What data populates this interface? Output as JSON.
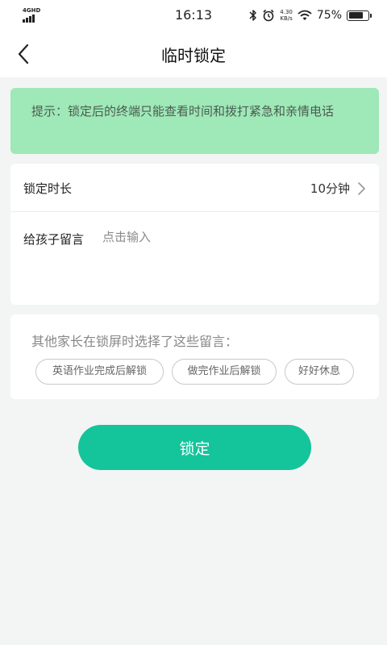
{
  "status_bar": {
    "network": "4GHD",
    "time": "16:13",
    "speed_value": "4.30",
    "speed_unit": "KB/s",
    "battery": "75%",
    "battery_level": 0.75
  },
  "nav": {
    "title": "临时锁定"
  },
  "tip": {
    "text": "提示：锁定后的终端只能查看时间和拨打紧急和亲情电话"
  },
  "lock_duration": {
    "label": "锁定时长",
    "value": "10分钟"
  },
  "message": {
    "label": "给孩子留言",
    "placeholder": "点击输入",
    "value": ""
  },
  "suggestions": {
    "title": "其他家长在锁屏时选择了这些留言：",
    "chips": [
      "英语作业完成后解锁",
      "做完作业后解锁",
      "好好休息"
    ]
  },
  "lock_button": {
    "label": "锁定"
  },
  "colors": {
    "accent": "#14c49b",
    "tip_background": "#9fe8b7",
    "tip_text": "#4a5c52",
    "page_background": "#f3f4f4"
  }
}
